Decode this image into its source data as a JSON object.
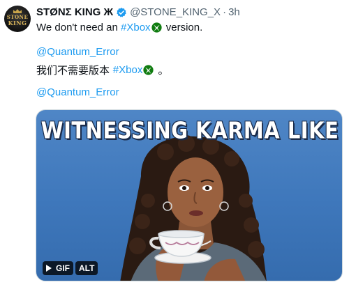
{
  "author": {
    "display_name": "STØNΣ KING Ж",
    "handle": "@STONE_KING_X",
    "separator": "·",
    "time": "3h",
    "avatar_text_top": "STONE",
    "avatar_text_bottom": "KING"
  },
  "tweet": {
    "line1_prefix": "We don't need an ",
    "line1_hashtag": "#Xbox",
    "line1_suffix": " version.",
    "mention1": "@Quantum_Error",
    "line3_prefix": "我们不需要版本 ",
    "line3_hashtag": "#Xbox",
    "line3_suffix": " 。",
    "mention2": "@Quantum_Error"
  },
  "media": {
    "caption": "WITNESSING KARMA LIKE",
    "gif_label": "GIF",
    "alt_label": "ALT"
  },
  "colors": {
    "link": "#1d9bf0",
    "verified": "#1d9bf0",
    "xbox_green": "#107c10",
    "media_background": "#4a80c2"
  },
  "icons": {
    "verified": "verified-badge-icon",
    "xbox": "xbox-logo-icon",
    "play": "play-icon"
  }
}
